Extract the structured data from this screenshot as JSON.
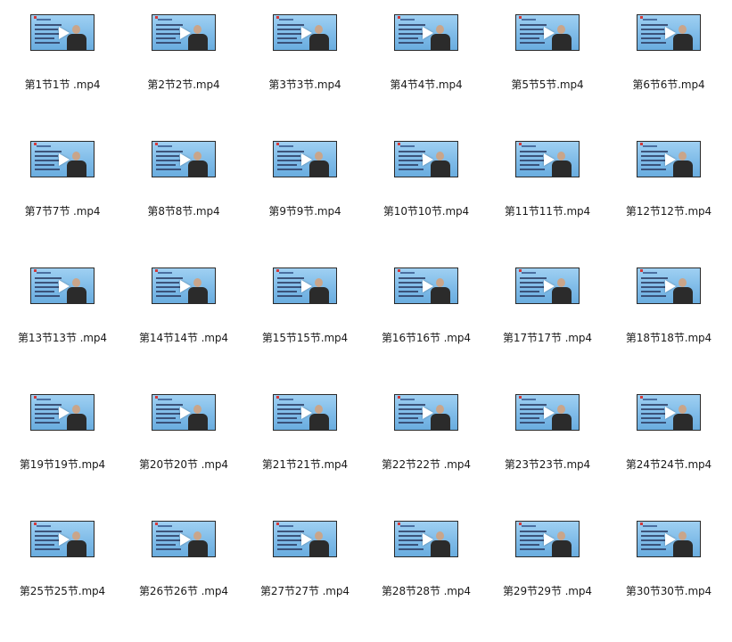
{
  "files": [
    {
      "name": "第1节1节 .mp4",
      "icon": "video-thumbnail-icon"
    },
    {
      "name": "第2节2节.mp4",
      "icon": "video-thumbnail-icon"
    },
    {
      "name": "第3节3节.mp4",
      "icon": "video-thumbnail-icon"
    },
    {
      "name": "第4节4节.mp4",
      "icon": "video-thumbnail-icon"
    },
    {
      "name": "第5节5节.mp4",
      "icon": "video-thumbnail-icon"
    },
    {
      "name": "第6节6节.mp4",
      "icon": "video-thumbnail-icon"
    },
    {
      "name": "第7节7节 .mp4",
      "icon": "video-thumbnail-icon"
    },
    {
      "name": "第8节8节.mp4",
      "icon": "video-thumbnail-icon"
    },
    {
      "name": "第9节9节.mp4",
      "icon": "video-thumbnail-icon"
    },
    {
      "name": "第10节10节.mp4",
      "icon": "video-thumbnail-icon"
    },
    {
      "name": "第11节11节.mp4",
      "icon": "video-thumbnail-icon"
    },
    {
      "name": "第12节12节.mp4",
      "icon": "video-thumbnail-icon"
    },
    {
      "name": "第13节13节 .mp4",
      "icon": "video-thumbnail-icon"
    },
    {
      "name": "第14节14节 .mp4",
      "icon": "video-thumbnail-icon"
    },
    {
      "name": "第15节15节.mp4",
      "icon": "video-thumbnail-icon"
    },
    {
      "name": "第16节16节 .mp4",
      "icon": "video-thumbnail-icon"
    },
    {
      "name": "第17节17节 .mp4",
      "icon": "video-thumbnail-icon"
    },
    {
      "name": "第18节18节.mp4",
      "icon": "video-thumbnail-icon"
    },
    {
      "name": "第19节19节.mp4",
      "icon": "video-thumbnail-icon"
    },
    {
      "name": "第20节20节 .mp4",
      "icon": "video-thumbnail-icon"
    },
    {
      "name": "第21节21节.mp4",
      "icon": "video-thumbnail-icon"
    },
    {
      "name": "第22节22节 .mp4",
      "icon": "video-thumbnail-icon"
    },
    {
      "name": "第23节23节.mp4",
      "icon": "video-thumbnail-icon"
    },
    {
      "name": "第24节24节.mp4",
      "icon": "video-thumbnail-icon"
    },
    {
      "name": "第25节25节.mp4",
      "icon": "video-thumbnail-icon"
    },
    {
      "name": "第26节26节 .mp4",
      "icon": "video-thumbnail-icon"
    },
    {
      "name": "第27节27节 .mp4",
      "icon": "video-thumbnail-icon"
    },
    {
      "name": "第28节28节 .mp4",
      "icon": "video-thumbnail-icon"
    },
    {
      "name": "第29节29节 .mp4",
      "icon": "video-thumbnail-icon"
    },
    {
      "name": "第30节30节.mp4",
      "icon": "video-thumbnail-icon"
    }
  ],
  "colors": {
    "background": "#ffffff",
    "slide": "#8cc4ec",
    "text": "#1a1a1a"
  }
}
